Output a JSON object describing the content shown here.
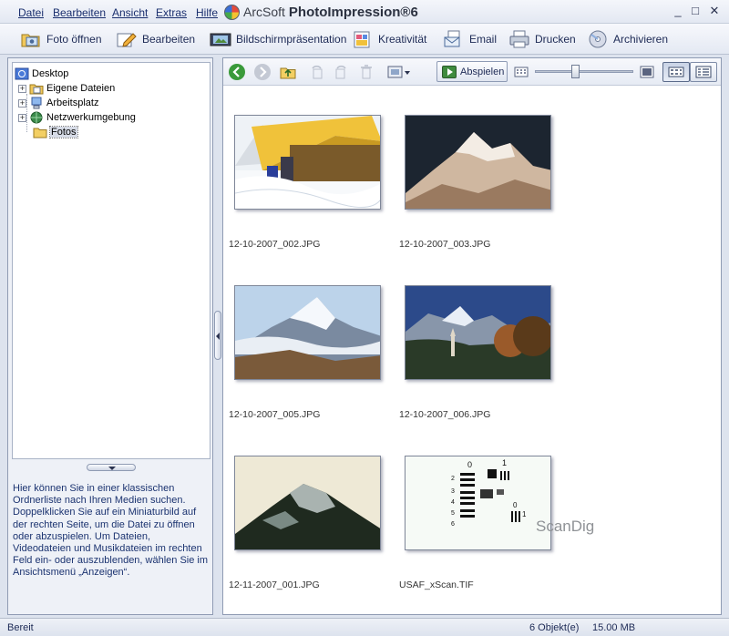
{
  "menu": [
    "Datei",
    "Bearbeiten",
    "Ansicht",
    "Extras",
    "Hilfe"
  ],
  "app_title": {
    "brand": "ArcSoft",
    "product": "PhotoImpression",
    "version": "®6"
  },
  "window_controls": [
    "_",
    "□",
    "✕"
  ],
  "toolbar": [
    {
      "label": "Foto öffnen",
      "icon": "open-photo-icon"
    },
    {
      "label": "Bearbeiten",
      "icon": "edit-pencil-icon"
    },
    {
      "label": "Bildschirmpräsentation",
      "icon": "slideshow-icon"
    },
    {
      "label": "Kreativität",
      "icon": "creativity-icon"
    },
    {
      "label": "Email",
      "icon": "email-icon"
    },
    {
      "label": "Drucken",
      "icon": "printer-icon"
    },
    {
      "label": "Archivieren",
      "icon": "archive-cd-icon"
    }
  ],
  "tree": [
    {
      "label": "Desktop",
      "icon": "desktop-icon",
      "level": 0,
      "expander": ""
    },
    {
      "label": "Eigene Dateien",
      "icon": "my-documents-icon",
      "level": 1,
      "expander": "+"
    },
    {
      "label": "Arbeitsplatz",
      "icon": "my-computer-icon",
      "level": 1,
      "expander": "+"
    },
    {
      "label": "Netzwerkumgebung",
      "icon": "network-icon",
      "level": 1,
      "expander": "+"
    },
    {
      "label": "Fotos",
      "icon": "folder-icon",
      "level": 1,
      "expander": "",
      "selected": true
    }
  ],
  "help_text": "Hier können Sie in einer klassischen Ordnerliste nach Ihren Medien suchen. Doppelklicken Sie auf ein Miniaturbild auf der rechten Seite, um die Datei zu öffnen oder abzuspielen. Um Dateien, Videodateien und Musikdateien im rechten Feld ein- oder auszublenden, wählen Sie im Ansichtsmenü „Anzeigen“.",
  "viewbar": {
    "play_label": "Abspielen",
    "zoom_level": 0.4,
    "icons": [
      "back-arrow-icon",
      "forward-arrow-icon",
      "up-folder-icon",
      "rotate-left-icon",
      "rotate-right-icon",
      "delete-icon",
      "view-mode-dropdown-icon",
      "small-thumbnails-icon",
      "large-thumbnail-icon",
      "thumbnail-view-icon",
      "details-view-icon"
    ]
  },
  "thumbnails": [
    {
      "filename": "12-10-2007_002.JPG",
      "scene": "tent-snow"
    },
    {
      "filename": "12-10-2007_003.JPG",
      "scene": "mountain-dark"
    },
    {
      "filename": "12-10-2007_005.JPG",
      "scene": "mountain-clouds"
    },
    {
      "filename": "12-10-2007_006.JPG",
      "scene": "alpine-village"
    },
    {
      "filename": "12-11-2007_001.JPG",
      "scene": "mountain-peak"
    },
    {
      "filename": "USAF_xScan.TIF",
      "scene": "resolution-chart"
    }
  ],
  "watermark": "ScanDig",
  "status": {
    "left": "Bereit",
    "count": "6 Objekt(e)",
    "size": "15.00 MB"
  },
  "colors": {
    "menu_text": "#1a2f6e",
    "help_text": "#1b3370",
    "pane_border": "#8f9bb3"
  }
}
